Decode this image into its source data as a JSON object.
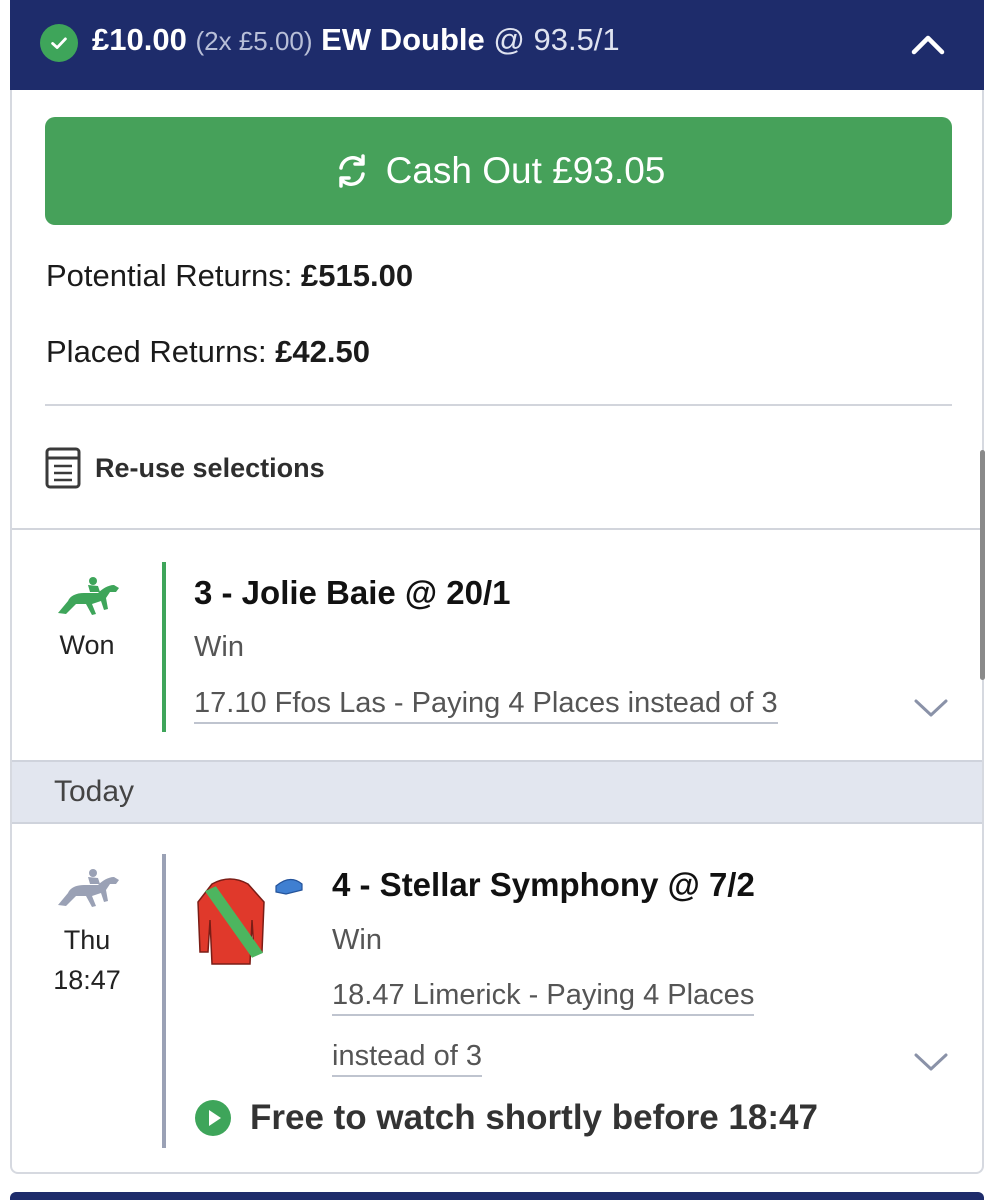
{
  "colors": {
    "header_bg": "#1e2c6b",
    "accent_green": "#46a15a",
    "won_green": "#3ea55a",
    "pending_grey": "#9aa1b5",
    "band_bg": "#e2e6ef"
  },
  "header": {
    "stake": "£10.00",
    "stake_detail": "(2x £5.00)",
    "bet_type": "EW Double",
    "odds": "@ 93.5/1",
    "status_icon": "check-circle-icon",
    "toggle_icon": "chevron-up-icon"
  },
  "cashout": {
    "icon": "refresh-icon",
    "label": "Cash Out £93.05"
  },
  "returns": {
    "potential_label": "Potential Returns:",
    "potential_value": "£515.00",
    "placed_label": "Placed Returns:",
    "placed_value": "£42.50"
  },
  "reuse": {
    "icon": "document-list-icon",
    "label": "Re-use selections"
  },
  "selections": [
    {
      "status": "Won",
      "icon": "horse-racing-icon",
      "title": "3 - Jolie Baie @ 20/1",
      "market": "Win",
      "event": "17.10 Ffos Las - Paying 4 Places instead of 3"
    },
    {
      "day": "Thu",
      "time": "18:47",
      "icon": "horse-racing-icon",
      "title": "4 - Stellar Symphony @ 7/2",
      "market": "Win",
      "event_line1": "18.47 Limerick - Paying 4 Places",
      "event_line2": "instead of 3",
      "watch": "Free to watch shortly before 18:47"
    }
  ],
  "group_header": "Today"
}
